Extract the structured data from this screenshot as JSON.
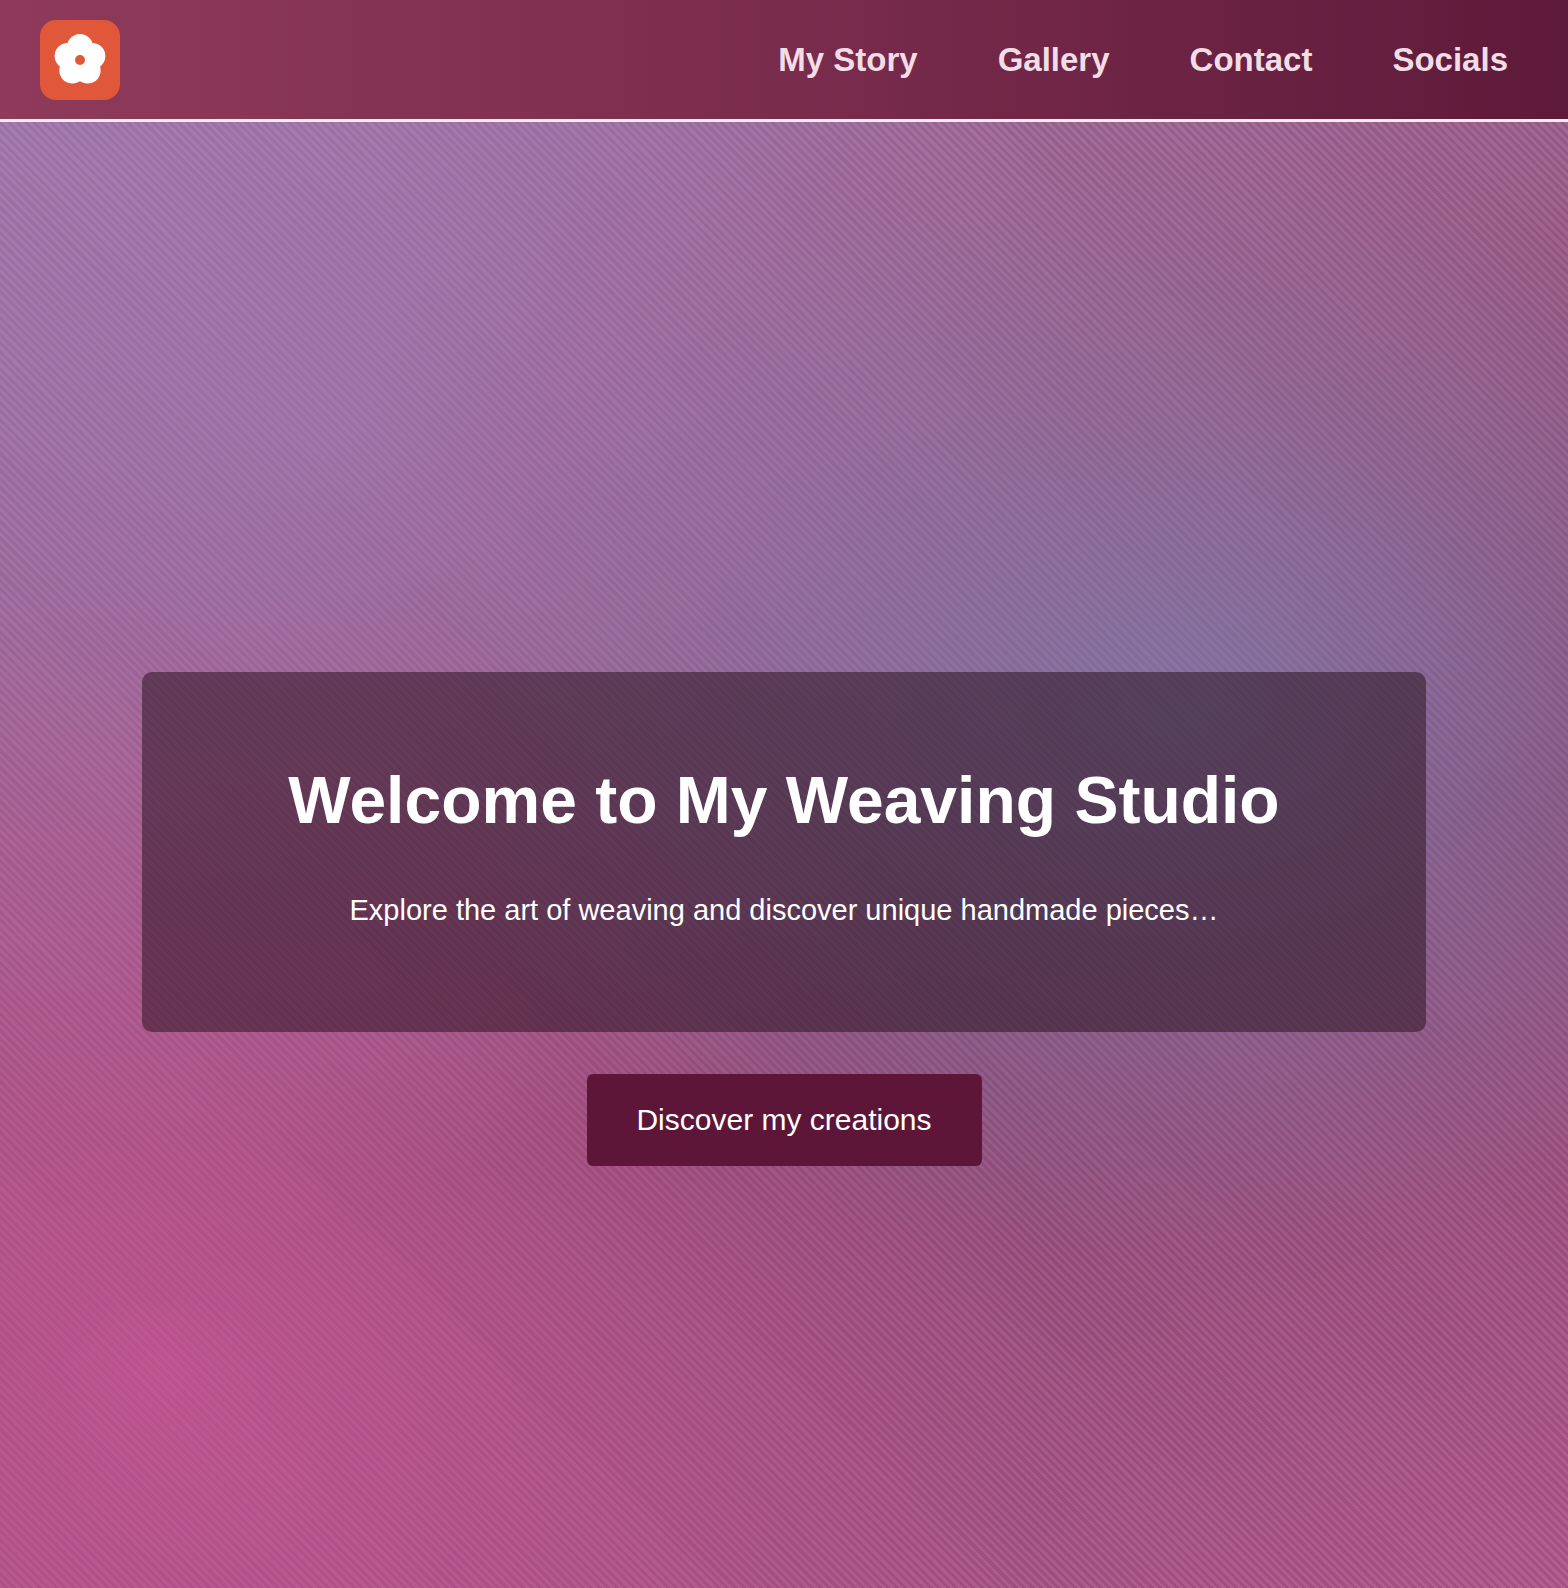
{
  "header": {
    "nav": [
      "My Story",
      "Gallery",
      "Contact",
      "Socials"
    ]
  },
  "hero": {
    "title": "Welcome to My Weaving Studio",
    "subtitle": "Explore the art of weaving and discover unique handmade pieces…",
    "button": "Discover my creations"
  }
}
